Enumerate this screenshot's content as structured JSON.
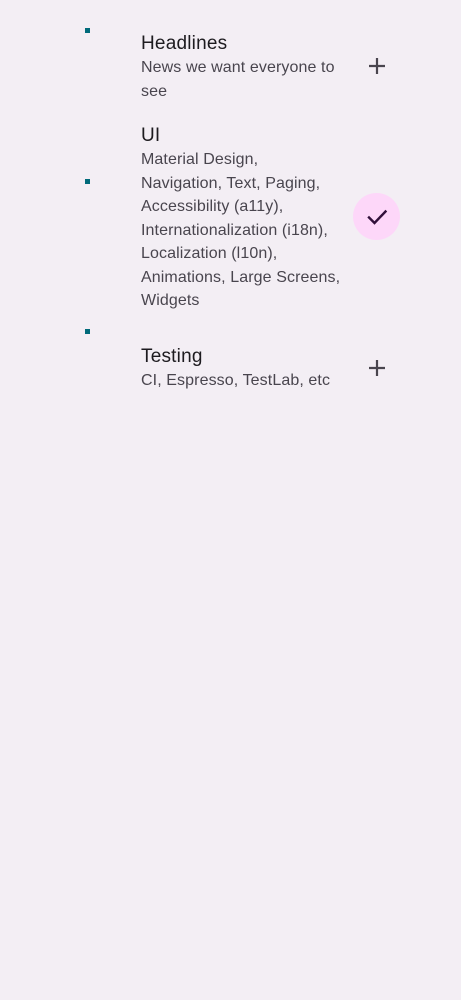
{
  "topics": [
    {
      "title": "Headlines",
      "description": "News we want everyone to see",
      "followed": false,
      "action_icon": "add-icon"
    },
    {
      "title": "UI",
      "description": "Material Design, Navigation, Text, Paging, Accessibility (a11y), Internationalization (i18n), Localization (l10n), Animations, Large Screens, Widgets",
      "followed": true,
      "action_icon": "check-icon"
    },
    {
      "title": "Testing",
      "description": "CI, Espresso, TestLab, etc",
      "followed": false,
      "action_icon": "add-icon"
    }
  ],
  "colors": {
    "background": "#f3eef4",
    "thumb": "#006a7a",
    "followed_bg": "#fdd7f9",
    "check": "#31103a",
    "add": "#49454e"
  }
}
